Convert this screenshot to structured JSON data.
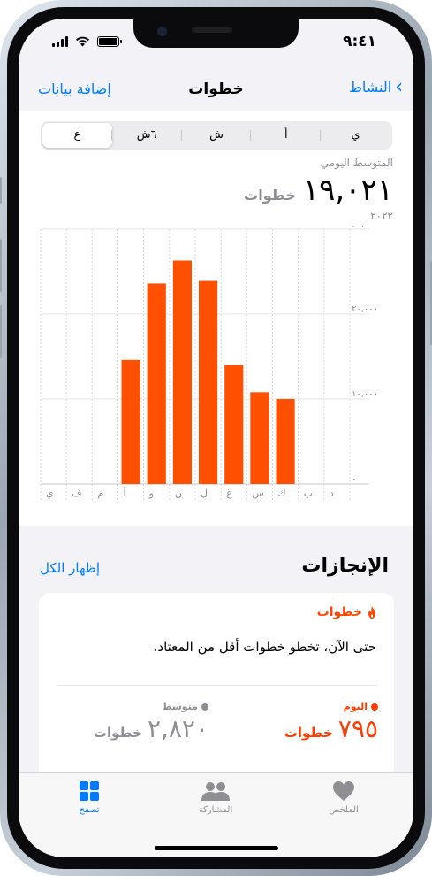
{
  "status": {
    "time": "٩:٤١"
  },
  "nav": {
    "back_label": "النشاط",
    "title": "خطوات",
    "add_label": "إضافة بيانات"
  },
  "segments": [
    {
      "label": "ي",
      "selected": false
    },
    {
      "label": "أ",
      "selected": false
    },
    {
      "label": "ش",
      "selected": false
    },
    {
      "label": "٦ش",
      "selected": false
    },
    {
      "label": "ع",
      "selected": true
    }
  ],
  "summary": {
    "average_label": "المتوسط اليومي",
    "average_value": "١٩,٠٢١",
    "unit": "خطوات",
    "year": "٢٠٢٢"
  },
  "chart_data": {
    "type": "bar",
    "categories": [
      "ي",
      "ف",
      "م",
      "أ",
      "م",
      "ي",
      "ي",
      "أ",
      "س",
      "أ",
      "ن",
      "د"
    ],
    "display_categories": [
      "ي",
      "ف",
      "م",
      "أ",
      "و",
      "ن",
      "ل",
      "غ",
      "س",
      "ك",
      "ب",
      "د"
    ],
    "values": [
      null,
      null,
      null,
      14600,
      23600,
      26300,
      23900,
      14000,
      10800,
      10000,
      null,
      null
    ],
    "ylim": [
      0,
      30000
    ],
    "yticks": [
      0,
      10000,
      20000,
      30000
    ],
    "ytick_labels": [
      "٠",
      "١٠,٠٠٠",
      "٢٠,٠٠٠",
      "٣٠,٠٠٠"
    ],
    "bar_color": "#ff4f00",
    "grid": true
  },
  "achievements": {
    "title": "الإنجازات",
    "show_all": "إظهار الكل",
    "card": {
      "category": "خطوات",
      "message": "حتى الآن، تخطو خطوات أقل من المعتاد.",
      "today_label": "اليوم",
      "today_value": "٧٩٥",
      "average_label": "متوسط",
      "average_value": "٢,٨٢٠",
      "unit": "خطوات",
      "today_color": "#ff3b00",
      "average_color": "#8e8e93"
    }
  },
  "tabbar": {
    "summary_label": "الملخص",
    "sharing_label": "المشاركة",
    "browse_label": "تصفح",
    "active_color": "#007aff"
  }
}
